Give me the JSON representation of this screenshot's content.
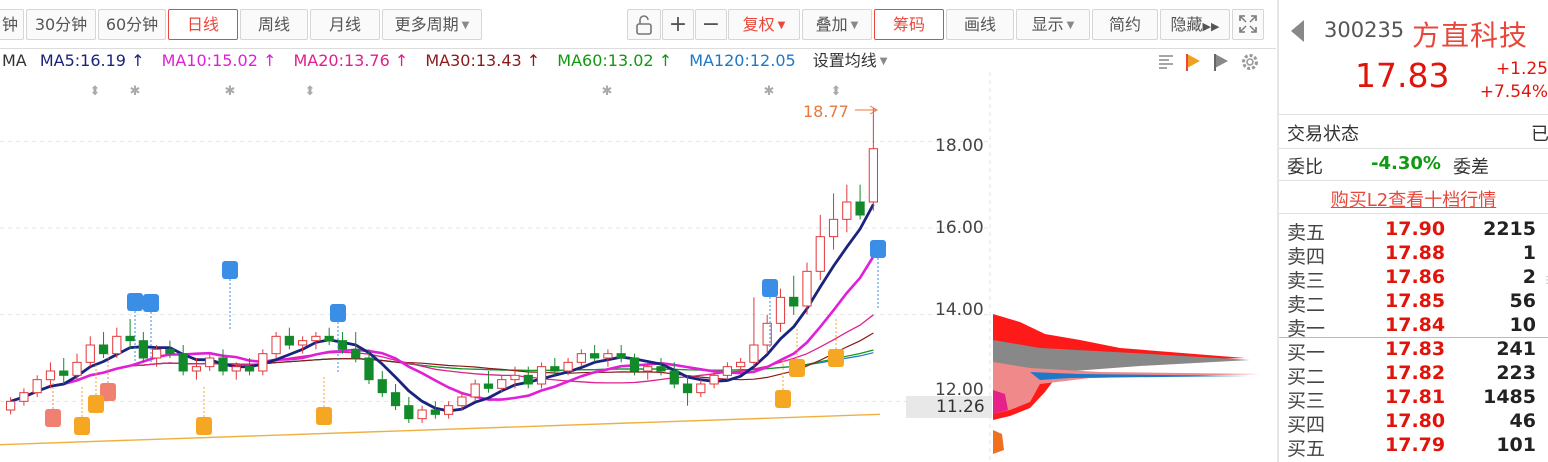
{
  "toolbar": {
    "periods": [
      "钟",
      "30分钟",
      "60分钟",
      "日线",
      "周线",
      "月线",
      "更多周期"
    ],
    "selected_period": "日线",
    "actions": [
      "复权",
      "叠加",
      "筹码",
      "画线",
      "显示",
      "简约",
      "隐藏"
    ]
  },
  "ma": {
    "label": "MA",
    "items": [
      {
        "text": "MA5:16.19",
        "arrow": "↑",
        "color": "#1a237e"
      },
      {
        "text": "MA10:15.02",
        "arrow": "↑",
        "color": "#e020d8"
      },
      {
        "text": "MA20:13.76",
        "arrow": "↑",
        "color": "#e0208e"
      },
      {
        "text": "MA30:13.43",
        "arrow": "↑",
        "color": "#8b1a1a"
      },
      {
        "text": "MA60:13.02",
        "arrow": "↑",
        "color": "#119911"
      },
      {
        "text": "MA120:12.05",
        "arrow": "",
        "color": "#1e78c8"
      }
    ],
    "settings": "设置均线"
  },
  "chart": {
    "high_label": "18.77",
    "price_axis": [
      "18.00",
      "16.00",
      "14.00",
      "12.00"
    ],
    "current_marker": "11.26"
  },
  "quote": {
    "code": "300235",
    "name": "方直科技",
    "price": "17.83",
    "change": "+1.25",
    "change_pct": "+7.54%",
    "trade_status_label": "交易状态",
    "trade_status_value": "已",
    "weibi_label": "委比",
    "weibi_value": "-4.30%",
    "weicha_label": "委差",
    "l2_link": "购买L2查看十档行情"
  },
  "orderbook": {
    "asks": [
      {
        "name": "卖五",
        "price": "17.90",
        "vol": "2215"
      },
      {
        "name": "卖四",
        "price": "17.88",
        "vol": "1"
      },
      {
        "name": "卖三",
        "price": "17.86",
        "vol": "2"
      },
      {
        "name": "卖二",
        "price": "17.85",
        "vol": "56"
      },
      {
        "name": "卖一",
        "price": "17.84",
        "vol": "10"
      }
    ],
    "bids": [
      {
        "name": "买一",
        "price": "17.83",
        "vol": "241"
      },
      {
        "name": "买二",
        "price": "17.82",
        "vol": "223"
      },
      {
        "name": "买三",
        "price": "17.81",
        "vol": "1485"
      },
      {
        "name": "买四",
        "price": "17.80",
        "vol": "46"
      },
      {
        "name": "买五",
        "price": "17.79",
        "vol": "101"
      }
    ]
  },
  "chart_data": {
    "type": "candlestick",
    "y_range": [
      10.6,
      19.6
    ],
    "y_ticks": [
      12,
      14,
      16,
      18
    ],
    "candles": [
      [
        11.8,
        12.1,
        11.7,
        12.0
      ],
      [
        12.0,
        12.3,
        11.9,
        12.2
      ],
      [
        12.2,
        12.6,
        12.1,
        12.5
      ],
      [
        12.5,
        12.9,
        12.3,
        12.7
      ],
      [
        12.7,
        13.0,
        12.4,
        12.6
      ],
      [
        12.6,
        13.1,
        12.5,
        12.9
      ],
      [
        12.9,
        13.5,
        12.8,
        13.3
      ],
      [
        13.3,
        13.6,
        13.0,
        13.1
      ],
      [
        13.1,
        13.7,
        13.0,
        13.5
      ],
      [
        13.5,
        13.9,
        13.2,
        13.4
      ],
      [
        13.4,
        13.6,
        12.9,
        13.0
      ],
      [
        13.0,
        13.3,
        12.8,
        13.2
      ],
      [
        13.2,
        13.4,
        13.0,
        13.1
      ],
      [
        13.1,
        13.3,
        12.6,
        12.7
      ],
      [
        12.7,
        13.0,
        12.5,
        12.8
      ],
      [
        12.8,
        13.1,
        12.7,
        13.0
      ],
      [
        13.0,
        13.2,
        12.6,
        12.7
      ],
      [
        12.7,
        12.9,
        12.5,
        12.8
      ],
      [
        12.8,
        13.0,
        12.6,
        12.7
      ],
      [
        12.7,
        13.2,
        12.6,
        13.1
      ],
      [
        13.1,
        13.6,
        13.0,
        13.5
      ],
      [
        13.5,
        13.7,
        13.2,
        13.3
      ],
      [
        13.3,
        13.5,
        13.1,
        13.4
      ],
      [
        13.4,
        13.6,
        13.2,
        13.5
      ],
      [
        13.5,
        13.7,
        13.3,
        13.4
      ],
      [
        13.4,
        13.6,
        13.1,
        13.2
      ],
      [
        13.2,
        13.6,
        12.9,
        13.0
      ],
      [
        13.0,
        13.2,
        12.4,
        12.5
      ],
      [
        12.5,
        12.7,
        12.1,
        12.2
      ],
      [
        12.2,
        12.4,
        11.8,
        11.9
      ],
      [
        11.9,
        12.1,
        11.5,
        11.6
      ],
      [
        11.6,
        11.9,
        11.5,
        11.8
      ],
      [
        11.8,
        12.0,
        11.6,
        11.7
      ],
      [
        11.7,
        12.0,
        11.6,
        11.9
      ],
      [
        11.9,
        12.2,
        11.8,
        12.1
      ],
      [
        12.1,
        12.5,
        12.0,
        12.4
      ],
      [
        12.4,
        12.7,
        12.2,
        12.3
      ],
      [
        12.3,
        12.6,
        12.2,
        12.5
      ],
      [
        12.5,
        12.8,
        12.3,
        12.6
      ],
      [
        12.6,
        12.8,
        12.3,
        12.4
      ],
      [
        12.4,
        12.9,
        12.3,
        12.8
      ],
      [
        12.8,
        13.0,
        12.6,
        12.7
      ],
      [
        12.7,
        13.0,
        12.6,
        12.9
      ],
      [
        12.9,
        13.2,
        12.8,
        13.1
      ],
      [
        13.1,
        13.3,
        12.9,
        13.0
      ],
      [
        13.0,
        13.2,
        12.8,
        13.1
      ],
      [
        13.1,
        13.3,
        12.9,
        13.0
      ],
      [
        13.0,
        13.1,
        12.6,
        12.7
      ],
      [
        12.7,
        12.9,
        12.5,
        12.8
      ],
      [
        12.8,
        13.0,
        12.6,
        12.7
      ],
      [
        12.7,
        12.9,
        12.3,
        12.4
      ],
      [
        12.4,
        12.6,
        11.9,
        12.2
      ],
      [
        12.2,
        12.5,
        12.1,
        12.4
      ],
      [
        12.4,
        12.7,
        12.3,
        12.6
      ],
      [
        12.6,
        12.9,
        12.5,
        12.8
      ],
      [
        12.8,
        13.0,
        12.7,
        12.9
      ],
      [
        12.9,
        14.4,
        12.8,
        13.3
      ],
      [
        13.3,
        14.0,
        13.1,
        13.8
      ],
      [
        13.8,
        14.6,
        13.6,
        14.4
      ],
      [
        14.4,
        14.9,
        14.0,
        14.2
      ],
      [
        14.2,
        15.2,
        14.0,
        15.0
      ],
      [
        15.0,
        16.3,
        14.8,
        15.8
      ],
      [
        15.8,
        16.8,
        15.5,
        16.2
      ],
      [
        16.2,
        17.0,
        15.9,
        16.6
      ],
      [
        16.6,
        17.0,
        16.2,
        16.3
      ],
      [
        16.6,
        18.77,
        16.4,
        17.83
      ]
    ]
  }
}
